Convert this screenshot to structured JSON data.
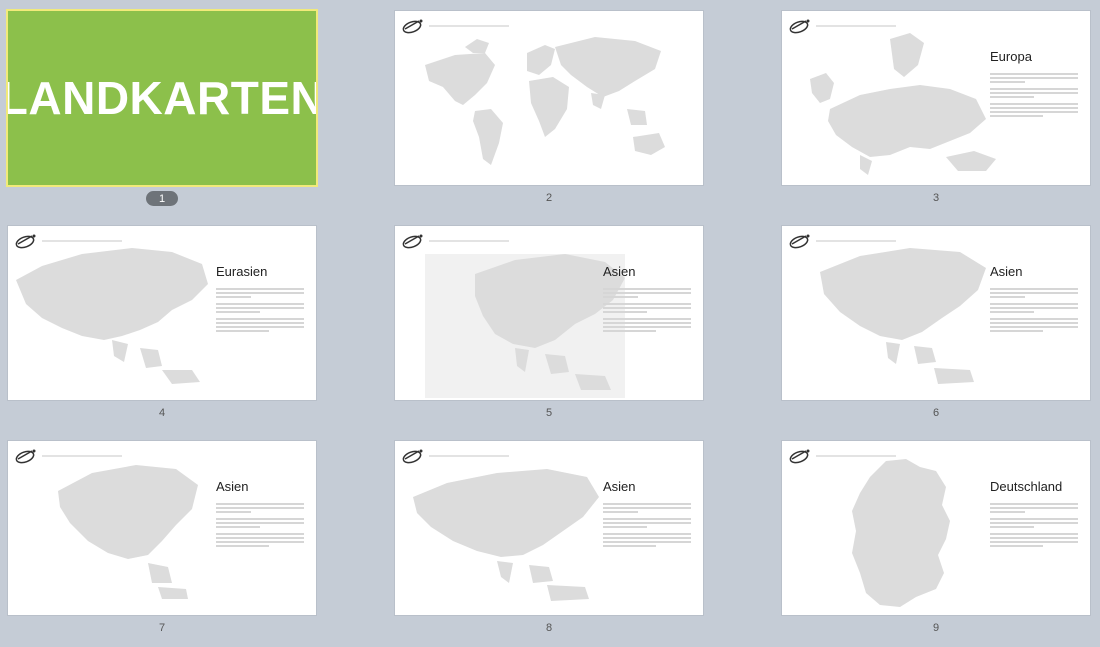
{
  "slides": [
    {
      "number": "1",
      "type": "title",
      "title": "LANDKARTEN"
    },
    {
      "number": "2",
      "type": "map-only"
    },
    {
      "number": "3",
      "type": "map-text",
      "heading": "Europa"
    },
    {
      "number": "4",
      "type": "map-text",
      "heading": "Eurasien"
    },
    {
      "number": "5",
      "type": "map-text",
      "heading": "Asien"
    },
    {
      "number": "6",
      "type": "map-text",
      "heading": "Asien"
    },
    {
      "number": "7",
      "type": "map-text",
      "heading": "Asien"
    },
    {
      "number": "8",
      "type": "map-text",
      "heading": "Asien"
    },
    {
      "number": "9",
      "type": "map-text",
      "heading": "Deutschland"
    }
  ],
  "colors": {
    "background": "#c5ccd6",
    "title_slide": "#8cc04b",
    "map_fill": "#dcdcdc",
    "selected_badge": "#6e7379"
  },
  "selected_slide": "1"
}
